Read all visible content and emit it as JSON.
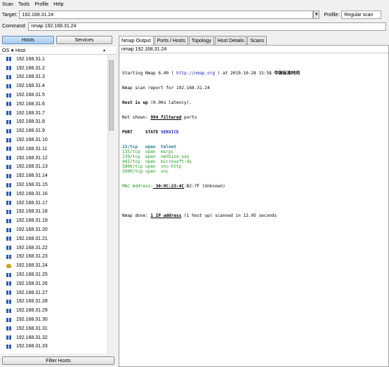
{
  "menu": [
    "Scan",
    "Tools",
    "Profile",
    "Help"
  ],
  "target": {
    "label": "Target:",
    "value": "192.168.31.24"
  },
  "profile": {
    "label": "Profile:",
    "value": "Regular scan"
  },
  "command": {
    "label": "Command:",
    "value": "nmap 192.168.31.24"
  },
  "left": {
    "hosts_btn": "Hosts",
    "services_btn": "Services",
    "col_os": "OS",
    "col_host": "Host",
    "filter_btn": "Filter Hosts",
    "hosts": [
      "192.168.31.1",
      "192.168.31.2",
      "192.168.31.3",
      "192.168.31.4",
      "192.168.31.5",
      "192.168.31.6",
      "192.168.31.7",
      "192.168.31.8",
      "192.168.31.9",
      "192.168.31.10",
      "192.168.31.11",
      "192.168.31.12",
      "192.168.31.13",
      "192.168.31.14",
      "192.168.31.15",
      "192.168.31.16",
      "192.168.31.17",
      "192.168.31.18",
      "192.168.31.19",
      "192.168.31.20",
      "192.168.31.21",
      "192.168.31.22",
      "192.168.31.23",
      "192.168.31.24",
      "192.168.31.25",
      "192.168.31.26",
      "192.168.31.27",
      "192.168.31.28",
      "192.168.31.29",
      "192.168.31.30",
      "192.168.31.31",
      "192.168.31.32",
      "192.168.31.33"
    ],
    "tux_host": "192.168.31.24"
  },
  "tabs": [
    "Nmap Output",
    "Ports / Hosts",
    "Topology",
    "Host Details",
    "Scans"
  ],
  "output": {
    "cmd": "nmap 192.168.31.24",
    "l1a": "Starting Nmap 6.40 ( ",
    "l1url": "http://nmap.org",
    "l1b": " ) at 2019-10-28 15:58 ",
    "l1tz": "中国标准时间",
    "l2": "Nmap scan report for 192.168.31.24",
    "l3a": "Host is up",
    "l3b": " (0.00s latency).",
    "l4a": "Not shown: ",
    "l4b": "994 filtered",
    "l4c": " ports",
    "hdr_port": "PORT",
    "hdr_state": "STATE",
    "hdr_service": "SERVICE",
    "ports": [
      {
        "port": "23/tcp  ",
        "state": "open ",
        "service": "telnet",
        "bold": true
      },
      {
        "port": "135/tcp ",
        "state": "open ",
        "service": "msrpc",
        "bold": false
      },
      {
        "port": "139/tcp ",
        "state": "open ",
        "service": "netbios-ssn",
        "bold": false
      },
      {
        "port": "445/tcp ",
        "state": "open ",
        "service": "microsoft-ds",
        "bold": false
      },
      {
        "port": "5800/tcp",
        "state": "open ",
        "service": "vnc-http",
        "bold": false
      },
      {
        "port": "5900/tcp",
        "state": "open ",
        "service": "vnc",
        "bold": false
      }
    ],
    "mac_a": "MAC Address:",
    "mac_b": " 30:9C:23:4C",
    "mac_c": ":B2:7F (Unknown)",
    "done_a": "Nmap done: ",
    "done_b": "1 IP address",
    "done_c": " (1 host up) scanned in 12.05 seconds"
  }
}
